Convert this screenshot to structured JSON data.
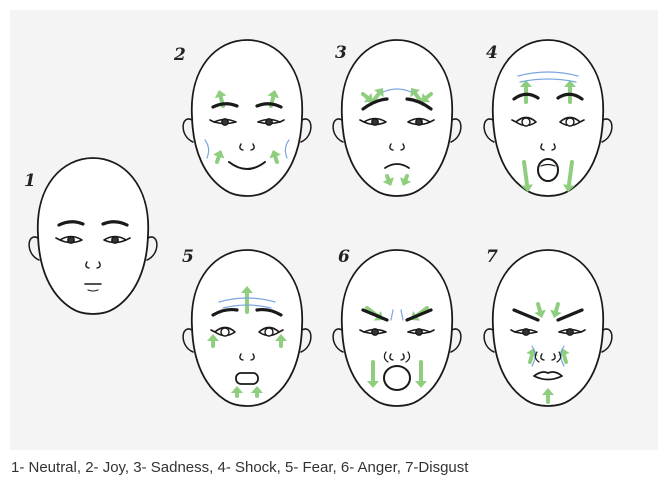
{
  "caption": "1- Neutral, 2- Joy, 3- Sadness, 4- Shock, 5- Fear, 6- Anger, 7-Disgust",
  "faces": [
    {
      "number": "1",
      "expression": "neutral"
    },
    {
      "number": "2",
      "expression": "joy"
    },
    {
      "number": "3",
      "expression": "sadness"
    },
    {
      "number": "4",
      "expression": "shock"
    },
    {
      "number": "5",
      "expression": "fear"
    },
    {
      "number": "6",
      "expression": "anger"
    },
    {
      "number": "7",
      "expression": "disgust"
    }
  ],
  "colors": {
    "frame_bg": "#f4f4f4",
    "arrow_green": "#8fce7e",
    "wrinkle_blue": "#7aa6e0",
    "ink": "#1a1a1a"
  }
}
